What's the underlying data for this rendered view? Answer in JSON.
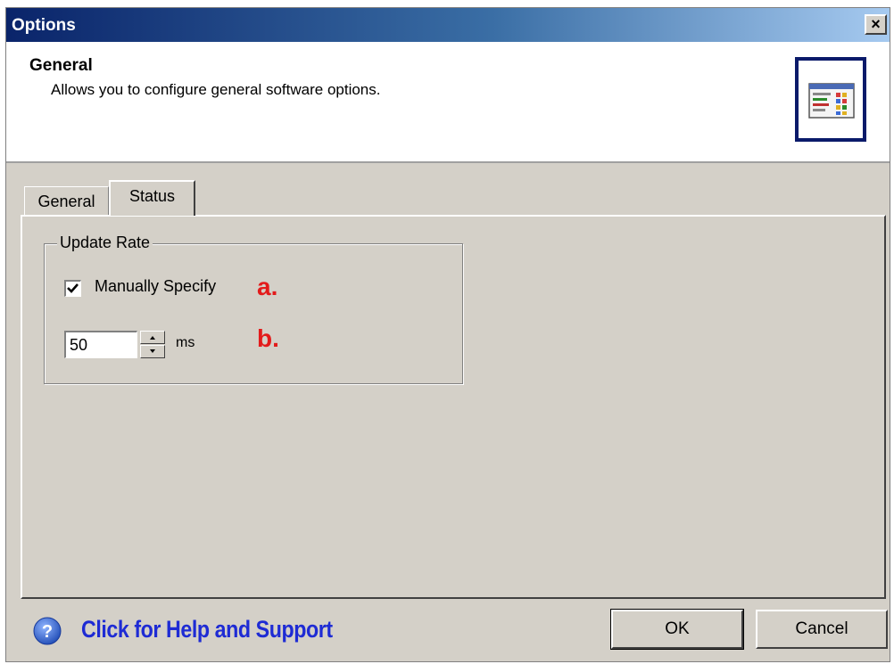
{
  "window": {
    "title": "Options",
    "close_glyph": "×"
  },
  "header": {
    "title": "General",
    "description": "Allows you to configure general software options.",
    "icon": "settings-window-icon"
  },
  "tabs": [
    {
      "label": "General",
      "active": false
    },
    {
      "label": "Status",
      "active": true
    }
  ],
  "update_rate": {
    "group_label": "Update Rate",
    "manual_checkbox_label": "Manually Specify",
    "manual_checked": true,
    "value": "50",
    "unit": "ms",
    "annotation_a": "a.",
    "annotation_b": "b."
  },
  "footer": {
    "help_text": "Click for Help and Support",
    "help_icon": "question-icon",
    "ok_label": "OK",
    "cancel_label": "Cancel"
  },
  "colors": {
    "annotation": "#e31b1b",
    "help_link": "#1e2bd4",
    "dialog_bg": "#d4d0c8",
    "titlebar_start": "#0a246a"
  }
}
